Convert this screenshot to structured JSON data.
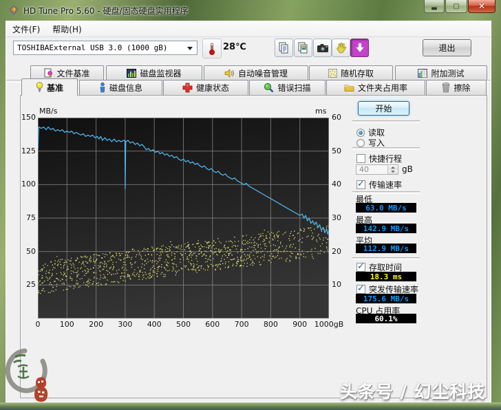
{
  "window": {
    "title": "HD Tune Pro 5.60 - 硬盘/固态硬盘实用程序"
  },
  "icons": {
    "app": "diamond-gem",
    "minimize": "dash",
    "maximize": "square-outline",
    "close": "x-cross",
    "thermometer": "red-thermometer",
    "copy_text": "two-documents-lines",
    "copy_image": "two-documents-picture",
    "camera": "black-camera",
    "hand": "yellow-hand",
    "download": "white-down-arrow-on-magenta",
    "dropdown": "down-triangle",
    "spinner": "up-down-triangles",
    "tab_file_benchmark": "document-with-bulb",
    "tab_disk_monitor": "bar-chart",
    "tab_aam": "speaker",
    "tab_random_access": "dotted-square",
    "tab_extra_tests": "mini-chart-grid",
    "tab_benchmark": "yellow-lightbulb",
    "tab_disk_info": "blue-info-figure",
    "tab_health": "red-cross",
    "tab_error_scan": "green-magnifier",
    "tab_folder_usage": "yellow-folder",
    "tab_erase": "trash-can",
    "stamp": "ink-brush-circle-with-red-seal"
  },
  "menu": {
    "items": [
      {
        "label": "文件(F)"
      },
      {
        "label": "帮助(H)"
      }
    ]
  },
  "toolbar": {
    "drive_select_value": "TOSHIBAExternal USB 3.0 (1000 gB)",
    "temperature": "28℃",
    "exit_label": "退出"
  },
  "tabs": {
    "row1": [
      {
        "label": "文件基准"
      },
      {
        "label": "磁盘监视器"
      },
      {
        "label": "自动噪音管理"
      },
      {
        "label": "随机存取"
      },
      {
        "label": "附加测试"
      }
    ],
    "row2": [
      {
        "label": "基准",
        "active": true
      },
      {
        "label": "磁盘信息"
      },
      {
        "label": "健康状态"
      },
      {
        "label": "错误扫描"
      },
      {
        "label": "文件夹占用率"
      },
      {
        "label": "擦除"
      }
    ]
  },
  "panel": {
    "start_button": "开始",
    "mode_read": "读取",
    "mode_write": "写入",
    "selected_mode": "读取",
    "short_stroke_label": "快捷行程",
    "short_stroke_checked": false,
    "short_stroke_value": "40",
    "short_stroke_unit": "gB",
    "transfer_rate_label": "传输速率",
    "transfer_rate_checked": true,
    "min_label": "最低",
    "min_value": "63.0 MB/s",
    "max_label": "最高",
    "max_value": "142.9 MB/s",
    "avg_label": "平均",
    "avg_value": "112.9 MB/s",
    "access_time_label": "存取时间",
    "access_time_checked": true,
    "access_time_value": "18.3 ms",
    "burst_rate_label": "突发传输速率",
    "burst_rate_checked": true,
    "burst_rate_value": "175.6 MB/s",
    "cpu_label": "CPU 占用率",
    "cpu_value": "60.1%"
  },
  "chart_data": {
    "type": "line",
    "x_axis": {
      "range": [
        0,
        1000
      ],
      "ticks": [
        0,
        100,
        200,
        300,
        400,
        500,
        600,
        700,
        800,
        900,
        1000
      ],
      "unit_suffix": "gB"
    },
    "left_axis": {
      "label": "MB/s",
      "range": [
        0,
        150
      ],
      "ticks": [
        150,
        125,
        100,
        75,
        50,
        25
      ]
    },
    "right_axis": {
      "label": "ms",
      "range": [
        0,
        60
      ],
      "ticks": [
        60,
        50,
        40,
        30,
        20,
        10
      ]
    },
    "grid": true,
    "plot_bg": [
      "#101010",
      "#343434"
    ],
    "grid_color": "#8b8b8b",
    "series": [
      {
        "name": "transfer_rate",
        "unit": "MB/s",
        "type": "line",
        "color": "#4db4e6",
        "points": [
          [
            0,
            127
          ],
          [
            3,
            143
          ],
          [
            12,
            142
          ],
          [
            20,
            143
          ],
          [
            28,
            141
          ],
          [
            36,
            143
          ],
          [
            44,
            141
          ],
          [
            52,
            142
          ],
          [
            60,
            140
          ],
          [
            68,
            141
          ],
          [
            76,
            140
          ],
          [
            84,
            141
          ],
          [
            92,
            139
          ],
          [
            100,
            140
          ],
          [
            108,
            139
          ],
          [
            116,
            140
          ],
          [
            124,
            138
          ],
          [
            132,
            139
          ],
          [
            140,
            138
          ],
          [
            148,
            137
          ],
          [
            156,
            138
          ],
          [
            164,
            136
          ],
          [
            172,
            137
          ],
          [
            180,
            136
          ],
          [
            188,
            137
          ],
          [
            196,
            135
          ],
          [
            204,
            136
          ],
          [
            210,
            134
          ],
          [
            216,
            136
          ],
          [
            222,
            133
          ],
          [
            230,
            135
          ],
          [
            238,
            133
          ],
          [
            246,
            134
          ],
          [
            254,
            132
          ],
          [
            262,
            134
          ],
          [
            270,
            132
          ],
          [
            278,
            133
          ],
          [
            286,
            132
          ],
          [
            294,
            133
          ],
          [
            299,
            133
          ],
          [
            300,
            97
          ],
          [
            302,
            132
          ],
          [
            310,
            133
          ],
          [
            318,
            131
          ],
          [
            326,
            132
          ],
          [
            334,
            130
          ],
          [
            342,
            131
          ],
          [
            350,
            129
          ],
          [
            358,
            130
          ],
          [
            366,
            128
          ],
          [
            372,
            126
          ],
          [
            380,
            127
          ],
          [
            388,
            125
          ],
          [
            396,
            126
          ],
          [
            404,
            124
          ],
          [
            412,
            125
          ],
          [
            420,
            123
          ],
          [
            428,
            124
          ],
          [
            436,
            122
          ],
          [
            444,
            123
          ],
          [
            452,
            121
          ],
          [
            460,
            122
          ],
          [
            468,
            120
          ],
          [
            476,
            121
          ],
          [
            484,
            119
          ],
          [
            492,
            118
          ],
          [
            500,
            119
          ],
          [
            508,
            117
          ],
          [
            516,
            118
          ],
          [
            524,
            116
          ],
          [
            532,
            117
          ],
          [
            540,
            115
          ],
          [
            548,
            116
          ],
          [
            556,
            114
          ],
          [
            564,
            113
          ],
          [
            572,
            114
          ],
          [
            580,
            112
          ],
          [
            588,
            111
          ],
          [
            596,
            112
          ],
          [
            604,
            110
          ],
          [
            612,
            109
          ],
          [
            620,
            110
          ],
          [
            628,
            108
          ],
          [
            636,
            107
          ],
          [
            644,
            108
          ],
          [
            652,
            106
          ],
          [
            660,
            105
          ],
          [
            668,
            104
          ],
          [
            676,
            105
          ],
          [
            684,
            103
          ],
          [
            692,
            102
          ],
          [
            700,
            101
          ],
          [
            708,
            100
          ],
          [
            716,
            101
          ],
          [
            724,
            99
          ],
          [
            732,
            98
          ],
          [
            740,
            97
          ],
          [
            748,
            96
          ],
          [
            756,
            95
          ],
          [
            764,
            94
          ],
          [
            772,
            93
          ],
          [
            780,
            92
          ],
          [
            788,
            91
          ],
          [
            796,
            90
          ],
          [
            804,
            89
          ],
          [
            812,
            88
          ],
          [
            820,
            87
          ],
          [
            828,
            86
          ],
          [
            836,
            85
          ],
          [
            844,
            84
          ],
          [
            852,
            83
          ],
          [
            860,
            82
          ],
          [
            868,
            81
          ],
          [
            876,
            80
          ],
          [
            884,
            79
          ],
          [
            892,
            78
          ],
          [
            900,
            77
          ],
          [
            908,
            78
          ],
          [
            914,
            75
          ],
          [
            920,
            77
          ],
          [
            926,
            73
          ],
          [
            932,
            75
          ],
          [
            938,
            71
          ],
          [
            944,
            73
          ],
          [
            950,
            70
          ],
          [
            956,
            72
          ],
          [
            962,
            68
          ],
          [
            968,
            70
          ],
          [
            974,
            66
          ],
          [
            980,
            68
          ],
          [
            986,
            64
          ],
          [
            992,
            67
          ],
          [
            996,
            63
          ],
          [
            1000,
            66
          ]
        ]
      },
      {
        "name": "access_time",
        "unit": "ms",
        "type": "scatter",
        "color": "#d8dc5c",
        "color_alt": "#eceec0",
        "generator": {
          "seed": 11,
          "count": 1200,
          "ms_min_start": 7,
          "ms_min_end": 18.5,
          "spread": 9.5,
          "sparse_after_x": 830,
          "sparse_keep": 0.5,
          "exponent": 0.85
        }
      }
    ],
    "stats": {
      "min_mbs": 63.0,
      "max_mbs": 142.9,
      "avg_mbs": 112.9,
      "access_ms": 18.3,
      "burst_mbs": 175.6,
      "cpu_pct": 60.1
    }
  },
  "watermarks": {
    "bottom_right": "头条号 / 幻尘科技"
  }
}
